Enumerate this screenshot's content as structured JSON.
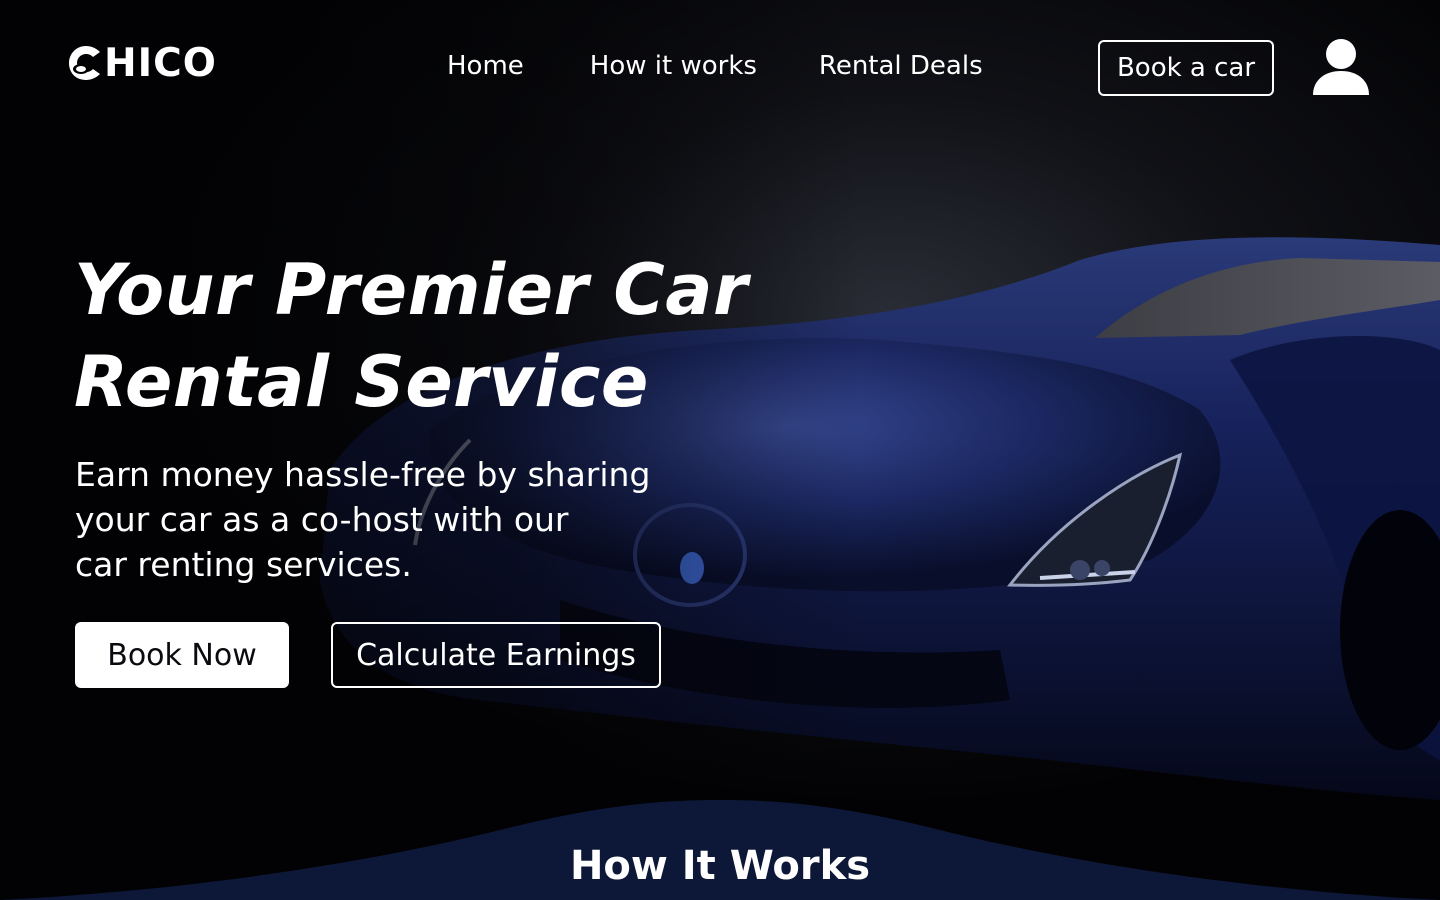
{
  "brand": {
    "name": "HICO",
    "logo_icon": "steering-wheel-c-icon"
  },
  "nav": {
    "links": [
      {
        "label": "Home"
      },
      {
        "label": "How it works"
      },
      {
        "label": "Rental Deals"
      }
    ],
    "cta_label": "Book a car",
    "user_icon": "user-icon"
  },
  "hero": {
    "title_line1": "Your Premier Car",
    "title_line2": "Rental Service",
    "description_lines": [
      "Earn money hassle-free by sharing",
      "your car as a co-host with our",
      "car renting services."
    ],
    "primary_button": "Book Now",
    "secondary_button": "Calculate Earnings",
    "background_image": "dark-blue-sports-car"
  },
  "how_it_works": {
    "title": "How It Works"
  },
  "colors": {
    "background": "#020204",
    "car_blue": "#1b2a5e",
    "wave": "#0d1838",
    "text": "#ffffff"
  }
}
